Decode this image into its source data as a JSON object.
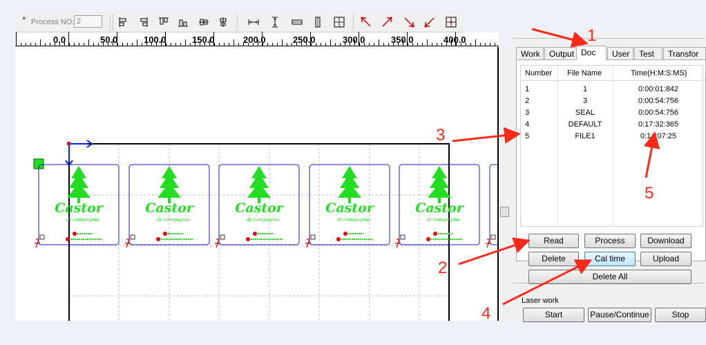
{
  "toolbar": {
    "degree_suffix": "°",
    "process_no_label": "Process NO:",
    "process_no_value": "2",
    "icons": [
      "align-left-icon",
      "align-right-icon",
      "align-top-icon",
      "align-bottom-icon",
      "align-hcenter-icon",
      "align-vcenter-icon",
      "same-width-icon",
      "same-height-icon",
      "same-size-icon",
      "center-icon",
      "grid-icon",
      "origin-topleft-icon",
      "origin-topright-icon",
      "origin-bottomright-icon",
      "origin-bottomleft-icon",
      "origin-center-icon"
    ]
  },
  "ruler": {
    "labels": [
      "0.0",
      "50.0",
      "100.0",
      "150.0",
      "200.0",
      "250.0",
      "300.0",
      "350.0",
      "400.0"
    ]
  },
  "canvas": {
    "item_brand": "Castor",
    "item_sub": "di compagnia",
    "accent_green": "#22dd22",
    "box_blue": "#1a1acc"
  },
  "panel": {
    "tabs": [
      "Work",
      "Output",
      "Doc",
      "User",
      "Test",
      "Transfor"
    ],
    "active_tab": "Doc",
    "table": {
      "headers": [
        "Number",
        "File Name",
        "Time(H:M:S:MS)"
      ],
      "rows": [
        [
          "1",
          "1",
          "0:00:01:842"
        ],
        [
          "2",
          "3",
          "0:00:54:756"
        ],
        [
          "3",
          "SEAL",
          "0:00:54:756"
        ],
        [
          "4",
          "DEFAULT",
          "0:17:32:365"
        ],
        [
          "5",
          "FILE1",
          "0:14:07:25"
        ]
      ]
    },
    "buttons": {
      "read": "Read",
      "process": "Process",
      "download": "Download",
      "delete": "Delete",
      "cal_time": "Cal time",
      "upload": "Upload",
      "delete_all": "Delete All"
    },
    "laser_work": {
      "label": "Laser work",
      "start": "Start",
      "pause": "Pause/Continue",
      "stop": "Stop"
    }
  },
  "annotations": {
    "n1": "1",
    "n2": "2",
    "n3": "3",
    "n4": "4",
    "n5": "5",
    "color": "#ff2a1a"
  }
}
